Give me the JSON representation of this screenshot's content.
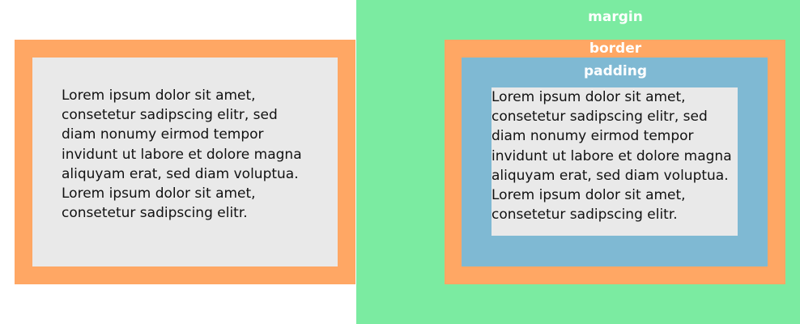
{
  "labels": {
    "margin": "margin",
    "border": "border",
    "padding": "padding"
  },
  "text": {
    "lorem": "Lorem ipsum dolor sit amet, consetetur sadipscing elitr, sed diam nonumy eirmod tempor invidunt ut labore et dolore magna aliquyam erat, sed diam voluptua. Lorem ipsum dolor sit amet, consetetur sadipscing elitr."
  },
  "colors": {
    "margin": "#7beba1",
    "border": "#ffa764",
    "padding": "#7fb9d3",
    "content": "#e9e9e9",
    "text": "#111111",
    "label": "#ffffff"
  }
}
